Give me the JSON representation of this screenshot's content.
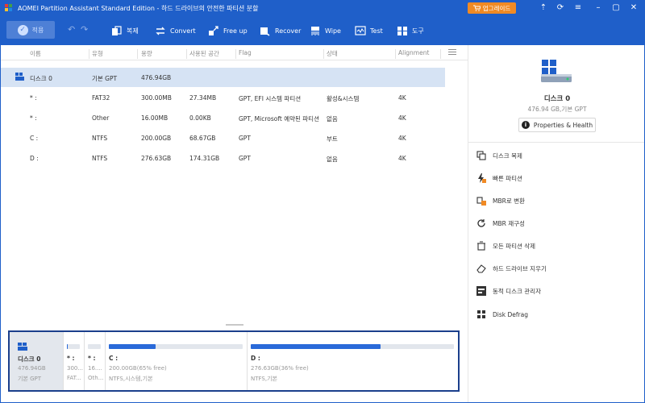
{
  "title": "AOMEI Partition Assistant Standard Edition - 하드 드라이브의 안전한 파티션 분할",
  "upgrade_label": "업그레이드",
  "colors": {
    "titlebar": "#1f5fc9",
    "accent": "#2a6ad9",
    "upgrade": "#f08a24",
    "selected_row": "#d6e3f4",
    "diskmap_border": "#1b3f8c"
  },
  "toolbar": {
    "apply": "적용",
    "tools": [
      {
        "label": "복제",
        "icon": "clone-icon"
      },
      {
        "label": "Convert",
        "icon": "convert-icon"
      },
      {
        "label": "Free up",
        "icon": "free-up-icon"
      },
      {
        "label": "Recover",
        "icon": "recover-icon"
      },
      {
        "label": "Wipe",
        "icon": "wipe-icon"
      },
      {
        "label": "Test",
        "icon": "test-icon"
      },
      {
        "label": "도구",
        "icon": "tools-icon"
      }
    ]
  },
  "table": {
    "headers": [
      "이름",
      "유형",
      "용량",
      "사용된 공간",
      "Flag",
      "상태",
      "Alignment"
    ],
    "rows": [
      {
        "name": "디스크 0",
        "type": "기본 GPT",
        "capacity": "476.94GB",
        "used": "",
        "flag": "",
        "status": "",
        "alignment": ""
      },
      {
        "name": "* :",
        "type": "FAT32",
        "capacity": "300.00MB",
        "used": "27.34MB",
        "flag": "GPT, EFI 시스템 파티션",
        "status": "활성&시스템",
        "alignment": "4K"
      },
      {
        "name": "* :",
        "type": "Other",
        "capacity": "16.00MB",
        "used": "0.00KB",
        "flag": "GPT, Microsoft 예약된 파티션",
        "status": "없음",
        "alignment": "4K"
      },
      {
        "name": "C :",
        "type": "NTFS",
        "capacity": "200.00GB",
        "used": "68.67GB",
        "flag": "GPT",
        "status": "부트",
        "alignment": "4K"
      },
      {
        "name": "D :",
        "type": "NTFS",
        "capacity": "276.63GB",
        "used": "174.31GB",
        "flag": "GPT",
        "status": "없음",
        "alignment": "4K"
      }
    ]
  },
  "right_panel": {
    "disk_name": "디스크 0",
    "disk_sub": "476.94 GB,기본 GPT",
    "properties_label": "Properties & Health",
    "operations": [
      {
        "label": "디스크 복제",
        "icon": "disk-clone-icon"
      },
      {
        "label": "빠른 파티션",
        "icon": "quick-partition-icon"
      },
      {
        "label": "MBR로 변환",
        "icon": "convert-mbr-icon"
      },
      {
        "label": "MBR 재구성",
        "icon": "rebuild-mbr-icon"
      },
      {
        "label": "모든 파티션 삭제",
        "icon": "delete-partitions-icon"
      },
      {
        "label": "하드 드라이브 지우기",
        "icon": "wipe-drive-icon"
      },
      {
        "label": "동적 디스크 관리자",
        "icon": "dynamic-disk-icon"
      },
      {
        "label": "Disk Defrag",
        "icon": "defrag-icon"
      }
    ]
  },
  "disk_map": {
    "disk": {
      "name": "디스크 0",
      "size": "476.94GB",
      "type": "기본 GPT"
    },
    "partitions": [
      {
        "name": "* :",
        "size": "300...",
        "fs": "FAT...",
        "used_fraction": 0.09
      },
      {
        "name": "* :",
        "size": "16....",
        "fs": "Oth...",
        "used_fraction": 0.0
      },
      {
        "name": "C :",
        "size": "200.00GB(65% free)",
        "fs": "NTFS,시스템,기본",
        "used_fraction": 0.35
      },
      {
        "name": "D :",
        "size": "276.63GB(36% free)",
        "fs": "NTFS,기본",
        "used_fraction": 0.64
      }
    ]
  }
}
